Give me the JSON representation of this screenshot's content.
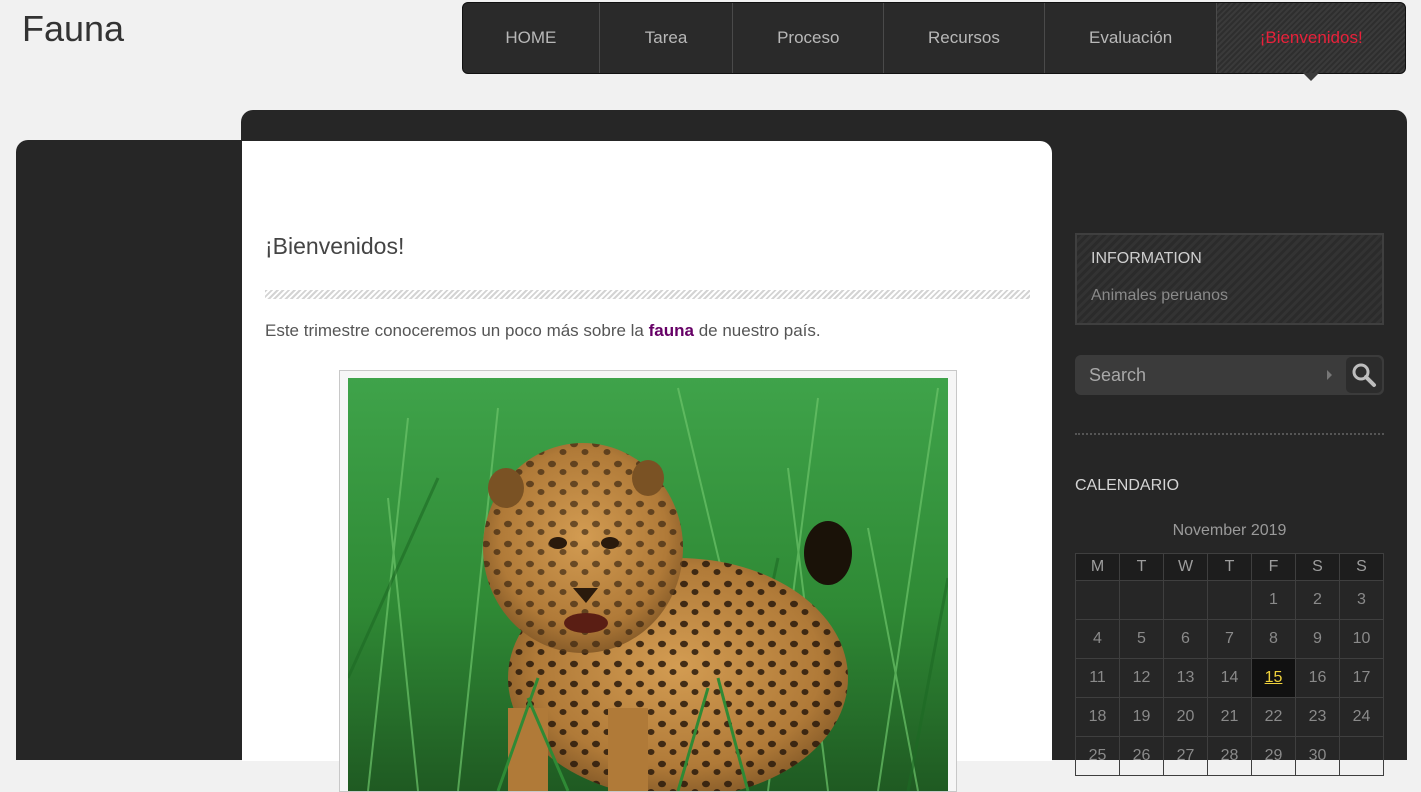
{
  "site": {
    "title": "Fauna"
  },
  "nav": {
    "items": [
      {
        "label": "HOME"
      },
      {
        "label": "Tarea"
      },
      {
        "label": "Proceso"
      },
      {
        "label": "Recursos"
      },
      {
        "label": "Evaluación"
      },
      {
        "label": "¡Bienvenidos!"
      }
    ],
    "active_color": "#e8213a"
  },
  "main": {
    "heading": "¡Bienvenidos!",
    "intro_before": "Este trimestre conoceremos un poco más sobre la ",
    "intro_link": "fauna",
    "intro_after": " de nuestro país.",
    "link_color": "#660066"
  },
  "sidebar": {
    "info": {
      "title": "INFORMATION",
      "text": "Animales peruanos"
    },
    "search": {
      "placeholder": "Search"
    },
    "calendar": {
      "title": "CALENDARIO",
      "caption": "November 2019",
      "days": [
        "M",
        "T",
        "W",
        "T",
        "F",
        "S",
        "S"
      ],
      "weeks": [
        [
          "",
          "",
          "",
          "",
          "1",
          "2",
          "3"
        ],
        [
          "4",
          "5",
          "6",
          "7",
          "8",
          "9",
          "10"
        ],
        [
          "11",
          "12",
          "13",
          "14",
          "15",
          "16",
          "17"
        ],
        [
          "18",
          "19",
          "20",
          "21",
          "22",
          "23",
          "24"
        ],
        [
          "25",
          "26",
          "27",
          "28",
          "29",
          "30",
          ""
        ]
      ],
      "today": "15",
      "today_color": "#f0d23c"
    }
  }
}
